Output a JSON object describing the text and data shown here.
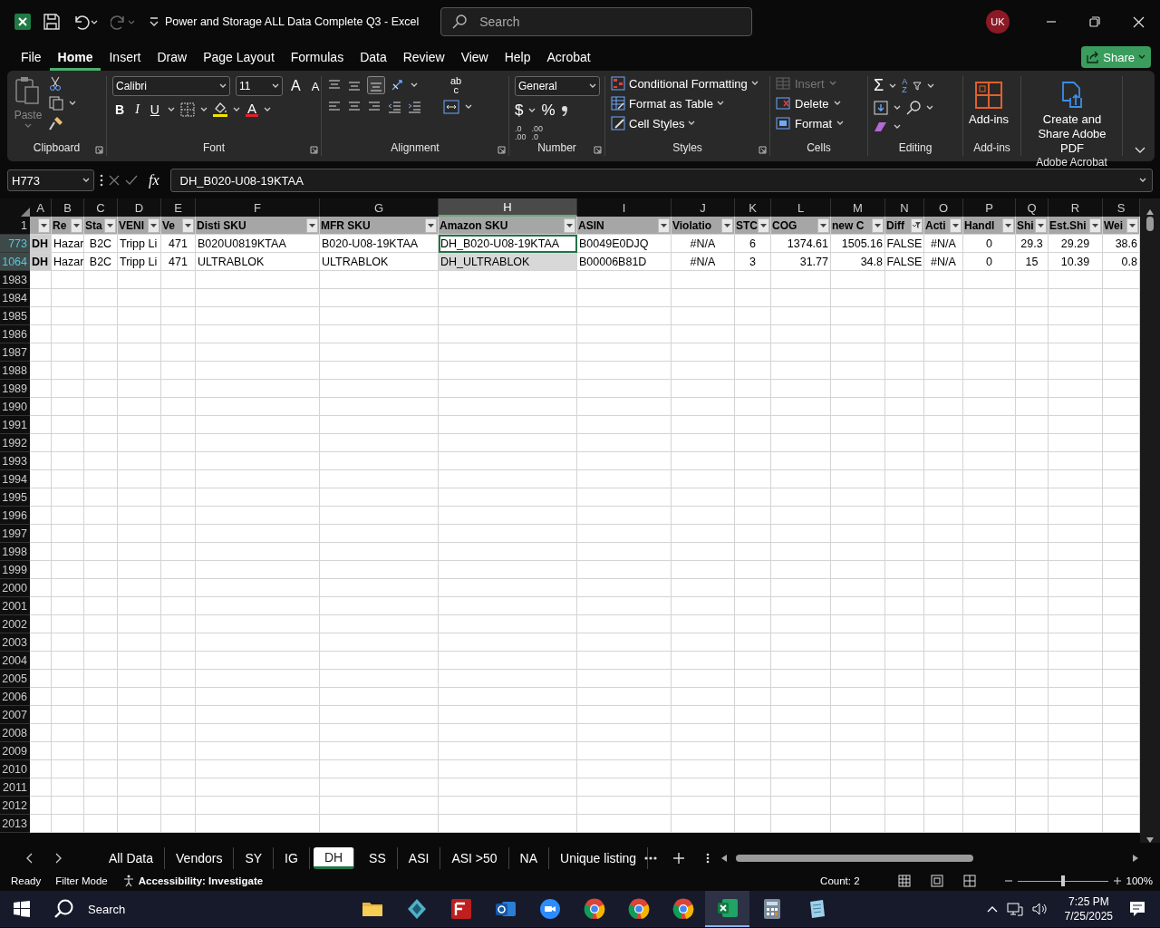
{
  "title_bar": {
    "title": "Power and Storage ALL Data Complete Q3  -  Excel",
    "search_placeholder": "Search",
    "user_initials": "UK"
  },
  "menu": [
    {
      "label": "File",
      "selected": false
    },
    {
      "label": "Home",
      "selected": true
    },
    {
      "label": "Insert",
      "selected": false
    },
    {
      "label": "Draw",
      "selected": false
    },
    {
      "label": "Page Layout",
      "selected": false
    },
    {
      "label": "Formulas",
      "selected": false
    },
    {
      "label": "Data",
      "selected": false
    },
    {
      "label": "Review",
      "selected": false
    },
    {
      "label": "View",
      "selected": false
    },
    {
      "label": "Help",
      "selected": false
    },
    {
      "label": "Acrobat",
      "selected": false
    }
  ],
  "share_button": "Share",
  "ribbon": {
    "clipboard": {
      "paste": "Paste",
      "group": "Clipboard"
    },
    "font": {
      "font_name": "Calibri",
      "font_size": "11",
      "grow": "A",
      "shrink": "A",
      "bold": "B",
      "italic": "I",
      "underline": "U",
      "font_color": "A",
      "group": "Font"
    },
    "alignment": {
      "wrap_glyphs": [
        "ab",
        "c"
      ],
      "group": "Alignment"
    },
    "number": {
      "format": "General",
      "currency": "$",
      "percent": "%",
      "increase_decimal": [
        ".0",
        ".00"
      ],
      "decrease_decimal": [
        ".00",
        ".0"
      ],
      "group": "Number"
    },
    "styles": {
      "items": [
        "Conditional Formatting",
        "Format as Table",
        "Cell Styles"
      ],
      "group": "Styles"
    },
    "cells": {
      "items": [
        {
          "label": "Insert",
          "disabled": true
        },
        {
          "label": "Delete",
          "disabled": false
        },
        {
          "label": "Format",
          "disabled": false
        }
      ],
      "group": "Cells"
    },
    "editing": {
      "sum": "Σ",
      "sort": [
        "A",
        "Z"
      ],
      "group": "Editing"
    },
    "addins": {
      "button": "Add-ins",
      "group": "Add-ins"
    },
    "acrobat": {
      "button": "Create and Share Adobe PDF",
      "group": "Adobe Acrobat"
    }
  },
  "formula_bar": {
    "name_box": "H773",
    "fx": "fx",
    "content": "DH_B020-U08-19KTAA"
  },
  "sheet": {
    "columns": [
      {
        "letter": "A",
        "selected": false,
        "filtered": false
      },
      {
        "letter": "B",
        "header": "Re",
        "selected": false,
        "filtered": false
      },
      {
        "letter": "C",
        "header": "Sta",
        "selected": false,
        "filtered": false
      },
      {
        "letter": "D",
        "header": "VENI",
        "selected": false,
        "filtered": false
      },
      {
        "letter": "E",
        "header": "Ve",
        "selected": false,
        "filtered": false
      },
      {
        "letter": "F",
        "header": "Disti SKU",
        "selected": false,
        "filtered": false
      },
      {
        "letter": "G",
        "header": "MFR SKU",
        "selected": false,
        "filtered": false
      },
      {
        "letter": "H",
        "header": "Amazon SKU",
        "selected": true,
        "filtered": false
      },
      {
        "letter": "I",
        "header": "ASIN",
        "selected": false,
        "filtered": false
      },
      {
        "letter": "J",
        "header": "Violatio",
        "selected": false,
        "filtered": false
      },
      {
        "letter": "K",
        "header": "STC",
        "selected": false,
        "filtered": false
      },
      {
        "letter": "L",
        "header": "COG",
        "selected": false,
        "filtered": false
      },
      {
        "letter": "M",
        "header": "new C",
        "selected": false,
        "filtered": false
      },
      {
        "letter": "N",
        "header": "Diff",
        "selected": false,
        "filtered": true
      },
      {
        "letter": "O",
        "header": "Acti",
        "selected": false,
        "filtered": false
      },
      {
        "letter": "P",
        "header": "Handl",
        "selected": false,
        "filtered": false
      },
      {
        "letter": "Q",
        "header": "Shi",
        "selected": false,
        "filtered": false
      },
      {
        "letter": "R",
        "header": "Est.Shi",
        "selected": false,
        "filtered": false
      },
      {
        "letter": "S",
        "header": "Wei",
        "selected": false,
        "filtered": false
      }
    ],
    "header_row": "1",
    "rows": [
      {
        "number": "773",
        "active": true,
        "cells": [
          "DH",
          "Hazar",
          "B2C",
          "Tripp Li",
          "471",
          "B020U0819KTAA",
          "B020-U08-19KTAA",
          "DH_B020-U08-19KTAA",
          "B0049E0DJQ",
          "#N/A",
          "6",
          "1374.61",
          "1505.16",
          "FALSE",
          "#N/A",
          "0",
          "29.3",
          "29.29",
          "38.6"
        ]
      },
      {
        "number": "1064",
        "active": false,
        "cells": [
          "DH",
          "Hazar",
          "B2C",
          "Tripp Li",
          "471",
          "ULTRABLOK",
          "ULTRABLOK",
          "DH_ULTRABLOK",
          "B00006B81D",
          "#N/A",
          "3",
          "31.77",
          "34.8",
          "FALSE",
          "#N/A",
          "0",
          "15",
          "10.39",
          "0.8"
        ]
      }
    ],
    "empty_rows": [
      "1983",
      "1984",
      "1985",
      "1986",
      "1987",
      "1988",
      "1989",
      "1990",
      "1991",
      "1992",
      "1993",
      "1994",
      "1995",
      "1996",
      "1997",
      "1998",
      "1999",
      "2000",
      "2001",
      "2002",
      "2003",
      "2004",
      "2005",
      "2006",
      "2007",
      "2008",
      "2009",
      "2010",
      "2011",
      "2012",
      "2013"
    ]
  },
  "sheet_tabs": [
    {
      "label": "All Data",
      "selected": false
    },
    {
      "label": "Vendors",
      "selected": false
    },
    {
      "label": "SY",
      "selected": false
    },
    {
      "label": "IG",
      "selected": false
    },
    {
      "label": "DH",
      "selected": true
    },
    {
      "label": "SS",
      "selected": false
    },
    {
      "label": "ASI",
      "selected": false
    },
    {
      "label": "ASI >50",
      "selected": false
    },
    {
      "label": "NA",
      "selected": false
    },
    {
      "label": "Unique listing",
      "selected": false
    }
  ],
  "status_bar": {
    "mode": "Ready",
    "filter": "Filter Mode",
    "accessibility": "Accessibility: Investigate",
    "count": "Count: 2",
    "zoom_slider": {
      "level": 0.5
    },
    "zoom": "100%"
  },
  "taskbar": {
    "search": "Search",
    "time": "7:25 PM",
    "date": "7/25/2025",
    "apps": [
      {
        "kind": "folder",
        "active": false
      },
      {
        "kind": "diamond",
        "active": false
      },
      {
        "kind": "ftp",
        "active": false
      },
      {
        "kind": "mail",
        "active": false
      },
      {
        "kind": "video",
        "active": false
      },
      {
        "kind": "browser",
        "active": false
      },
      {
        "kind": "browser",
        "active": false
      },
      {
        "kind": "browser",
        "active": false
      },
      {
        "kind": "sheet",
        "active": true
      },
      {
        "kind": "calculator",
        "active": false
      },
      {
        "kind": "notes",
        "active": false
      }
    ]
  }
}
